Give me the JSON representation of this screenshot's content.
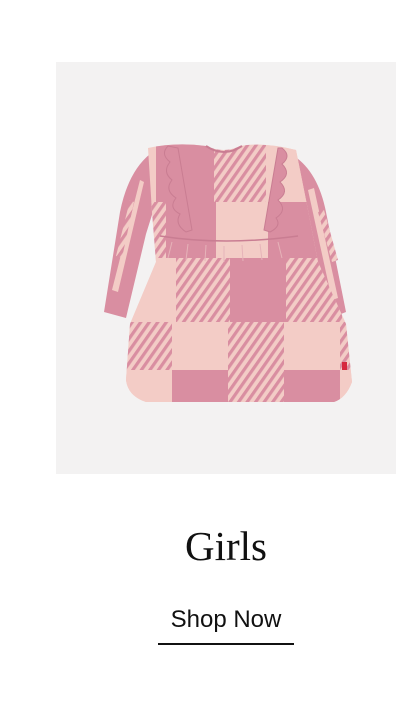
{
  "promo": {
    "category_title": "Girls",
    "cta_label": "Shop Now",
    "image_description_icon": "dress-image"
  },
  "colors": {
    "panel_background": "#f3f2f2",
    "dress_pink": "#d98ea1",
    "dress_blush": "#f3ccc6",
    "text": "#111111"
  }
}
